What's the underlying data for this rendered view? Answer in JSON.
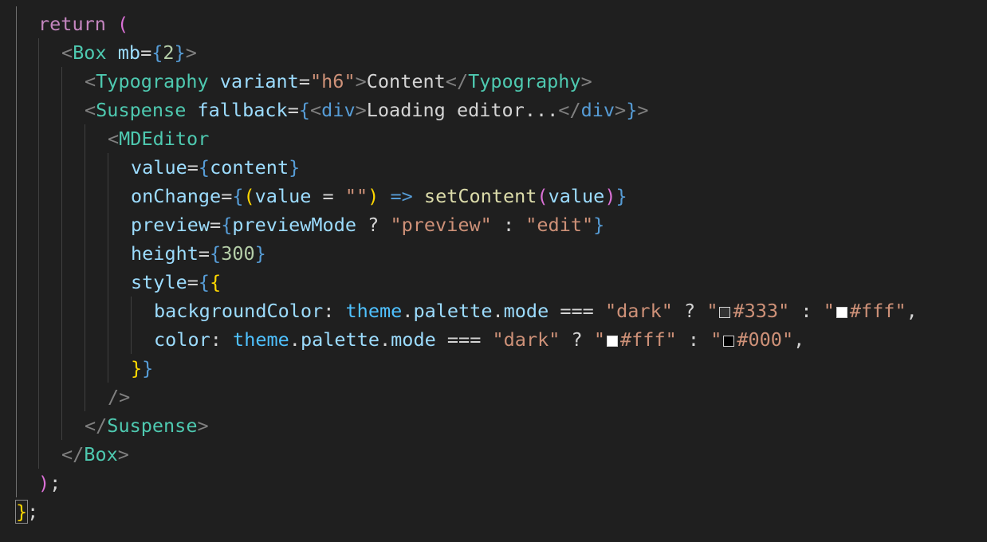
{
  "editor": {
    "language": "jsx",
    "theme": "dark",
    "colors": {
      "background": "#1f1f1f",
      "keyword": "#c586c0",
      "component_tag": "#4ec9b0",
      "html_tag": "#569cd6",
      "attribute": "#9cdcfe",
      "string": "#ce9178",
      "number": "#b5cea8",
      "function": "#dcdcaa",
      "bracket_gold": "#ffd700",
      "bracket_blue": "#569cd6",
      "bracket_pink": "#da70d6"
    },
    "swatches": [
      {
        "label": "#333",
        "fill": "#333333"
      },
      {
        "label": "#fff",
        "fill": "#ffffff"
      },
      {
        "label": "#fff",
        "fill": "#ffffff"
      },
      {
        "label": "#000",
        "fill": "#000000"
      }
    ]
  },
  "code": {
    "l1": {
      "kw": "return",
      "paren": "("
    },
    "l2": {
      "lt": "<",
      "tag": "Box",
      "attr": "mb",
      "eq": "=",
      "ob": "{",
      "num": "2",
      "cb": "}",
      "gt": ">"
    },
    "l3": {
      "lt": "<",
      "tag": "Typography",
      "attr": "variant",
      "eq": "=",
      "str": "\"h6\"",
      "gt": ">",
      "text": "Content",
      "lt2": "</",
      "tag2": "Typography",
      "gt2": ">"
    },
    "l4": {
      "lt": "<",
      "tag": "Suspense",
      "attr": "fallback",
      "eq": "=",
      "ob": "{",
      "lt2": "<",
      "tag2": "div",
      "gt2": ">",
      "text": "Loading editor...",
      "lt3": "</",
      "tag3": "div",
      "gt3": ">",
      "cb": "}",
      "gt": ">"
    },
    "l5": {
      "lt": "<",
      "tag": "MDEditor"
    },
    "l6": {
      "attr": "value",
      "eq": "=",
      "ob": "{",
      "var": "content",
      "cb": "}"
    },
    "l7": {
      "attr": "onChange",
      "eq": "=",
      "ob": "{",
      "op": "(",
      "param": "value",
      "assign": " = ",
      "str": "\"\"",
      "cp": ")",
      "arrow": "=>",
      "fn": "setContent",
      "op2": "(",
      "arg": "value",
      "cp2": ")",
      "cb": "}"
    },
    "l8": {
      "attr": "preview",
      "eq": "=",
      "ob": "{",
      "var": "previewMode",
      "q": " ? ",
      "str1": "\"preview\"",
      "colon": " : ",
      "str2": "\"edit\"",
      "cb": "}"
    },
    "l9": {
      "attr": "height",
      "eq": "=",
      "ob": "{",
      "num": "300",
      "cb": "}"
    },
    "l10": {
      "attr": "style",
      "eq": "=",
      "ob": "{",
      "ob2": "{"
    },
    "l11": {
      "prop": "backgroundColor",
      "colon": ": ",
      "theme": "theme",
      "dot1": ".",
      "palette": "palette",
      "dot2": ".",
      "mode": "mode",
      "eqq": " === ",
      "str1": "\"dark\"",
      "q": " ? ",
      "qa": "\"",
      "sw1": "#333",
      "qb": "\"",
      "colon2": " : ",
      "qc": "\"",
      "sw2": "#fff",
      "qd": "\"",
      "comma": ","
    },
    "l12": {
      "prop": "color",
      "colon": ": ",
      "theme": "theme",
      "dot1": ".",
      "palette": "palette",
      "dot2": ".",
      "mode": "mode",
      "eqq": " === ",
      "str1": "\"dark\"",
      "q": " ? ",
      "qa": "\"",
      "sw1": "#fff",
      "qb": "\"",
      "colon2": " : ",
      "qc": "\"",
      "sw2": "#000",
      "qd": "\"",
      "comma": ","
    },
    "l13": {
      "cb2": "}",
      "cb": "}"
    },
    "l14": {
      "close": "/>"
    },
    "l15": {
      "lt": "</",
      "tag": "Suspense",
      "gt": ">"
    },
    "l16": {
      "lt": "</",
      "tag": "Box",
      "gt": ">"
    },
    "l17": {
      "paren": ")",
      "semi": ";"
    },
    "l18": {
      "brace": "}",
      "semi": ";"
    }
  }
}
